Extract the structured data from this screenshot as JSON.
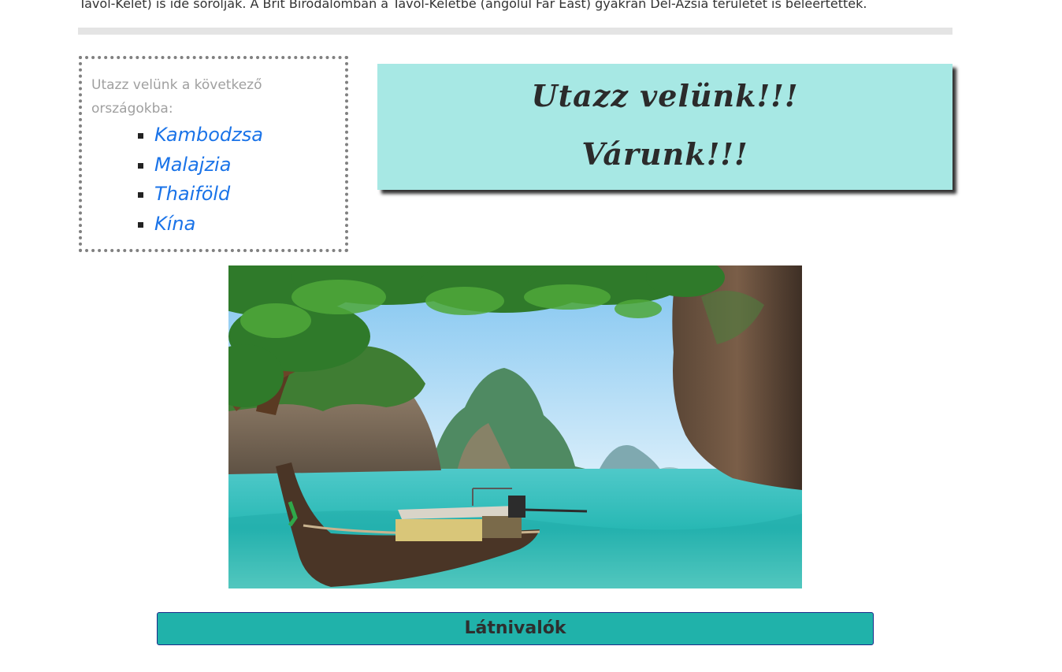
{
  "intro_text": "Távol-Kelet) is ide sorolják. A Brit Birodalomban a Távol-Keletbe (angolul Far East) gyakran Dél-Ázsia területét is beleértették.",
  "sidebar": {
    "intro": "Utazz velünk a következő országokba:",
    "countries": [
      {
        "label": "Kambodzsa"
      },
      {
        "label": "Malajzia"
      },
      {
        "label": "Thaiföld"
      },
      {
        "label": "Kína"
      }
    ]
  },
  "banner": {
    "line1": "Utazz velünk!!!",
    "line2": "Várunk!!!",
    "background": "#a7e8e4"
  },
  "sights_button": {
    "label": "Látnivalók",
    "color": "#20b2aa"
  },
  "colors": {
    "link": "#1a73e8",
    "divider": "#e4e4e4",
    "box_border": "#808080"
  }
}
